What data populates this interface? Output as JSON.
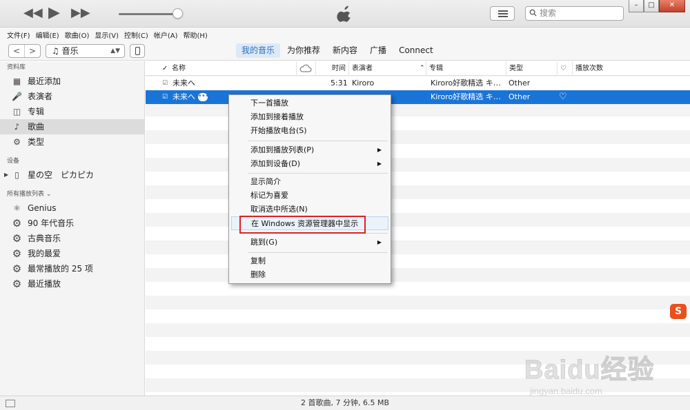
{
  "player": {
    "prev_icon": "rewind-icon",
    "play_icon": "play-icon",
    "next_icon": "fast-forward-icon",
    "volume_fraction": 0.9,
    "search_placeholder": "搜索"
  },
  "menubar": [
    "文件(F)",
    "编辑(E)",
    "歌曲(O)",
    "显示(V)",
    "控制(C)",
    "帐户(A)",
    "帮助(H)"
  ],
  "nav": {
    "media_label": "音乐",
    "tabs": [
      "我的音乐",
      "为你推荐",
      "新内容",
      "广播",
      "Connect"
    ],
    "active_tab": "我的音乐"
  },
  "sidebar": {
    "library_title": "资料库",
    "library_items": [
      "最近添加",
      "表演者",
      "专辑",
      "歌曲",
      "类型"
    ],
    "selected_item": "歌曲",
    "devices_title": "设备",
    "device_name": "星の空　ピカピカ",
    "playlists_title": "所有播放列表 ⌄",
    "playlists": [
      "Genius",
      "90 年代音乐",
      "古典音乐",
      "我的最爱",
      "最常播放的 25 项",
      "最近播放"
    ]
  },
  "table": {
    "headers": {
      "check": "✓",
      "name": "名称",
      "time": "时间",
      "artist": "表演者",
      "album": "专辑",
      "genre": "类型",
      "plays": "播放次数"
    },
    "rows": [
      {
        "name": "未来へ",
        "time": "5:31",
        "artist": "Kiroro",
        "album": "Kiroro好歌精选 キ…",
        "genre": "Other"
      },
      {
        "name": "未来へ",
        "time": "",
        "artist": "",
        "album": "Kiroro好歌精选 キ…",
        "genre": "Other"
      }
    ]
  },
  "context_menu": {
    "groups": [
      [
        "下一首播放",
        "添加到接着播放",
        "开始播放电台(S)"
      ],
      [
        "添加到播放列表(P)",
        "添加到设备(D)"
      ],
      [
        "显示简介",
        "标记为喜爱",
        "取消选中所选(N)",
        "在 Windows 资源管理器中显示"
      ],
      [
        "跳到(G)"
      ],
      [
        "复制",
        "删除"
      ]
    ],
    "highlighted": "在 Windows 资源管理器中显示"
  },
  "status": "2 首歌曲, 7 分钟, 6.5 MB",
  "watermark": {
    "main": "Baidu经验",
    "sub": "jingyan.baidu.com"
  },
  "colors": {
    "selection": "#1a74d8",
    "highlight_box": "#e02020",
    "active_tab": "#2a6fbb"
  }
}
